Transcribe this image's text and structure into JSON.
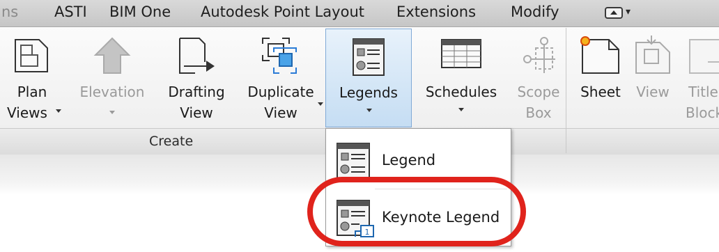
{
  "tabs": [
    {
      "label": "ns",
      "dim": true
    },
    {
      "label": "ASTI"
    },
    {
      "label": "BIM One"
    },
    {
      "label": "Autodesk Point Layout"
    },
    {
      "label": "Extensions"
    },
    {
      "label": "Modify"
    }
  ],
  "ribbon": {
    "panel_title": "Create",
    "buttons": [
      {
        "line1": "Plan",
        "line2": "Views",
        "icon": "plan-views-icon",
        "enabled": true
      },
      {
        "line1": "Elevation",
        "icon": "elevation-icon",
        "enabled": false
      },
      {
        "line1": "Drafting",
        "line2": "View",
        "icon": "drafting-view-icon",
        "enabled": true
      },
      {
        "line1": "Duplicate",
        "line2": "View",
        "icon": "duplicate-view-icon",
        "enabled": true
      },
      {
        "line1": "Legends",
        "icon": "legends-icon",
        "enabled": true,
        "active": true
      },
      {
        "line1": "Schedules",
        "icon": "schedules-icon",
        "enabled": true
      },
      {
        "line1": "Scope",
        "line2": "Box",
        "icon": "scope-box-icon",
        "enabled": false
      },
      {
        "line1": "Sheet",
        "icon": "sheet-icon",
        "enabled": true
      },
      {
        "line1": "View",
        "icon": "view-placement-icon",
        "enabled": false
      },
      {
        "line1": "Title",
        "line2": "Block",
        "icon": "title-block-icon",
        "enabled": false
      }
    ]
  },
  "dropdown": {
    "items": [
      {
        "label": "Legend",
        "icon": "legend-icon"
      },
      {
        "label": "Keynote Legend",
        "icon": "keynote-legend-icon",
        "highlighted": true
      }
    ]
  },
  "colors": {
    "highlight": "#e0231c",
    "active": "#c5ddf3"
  }
}
